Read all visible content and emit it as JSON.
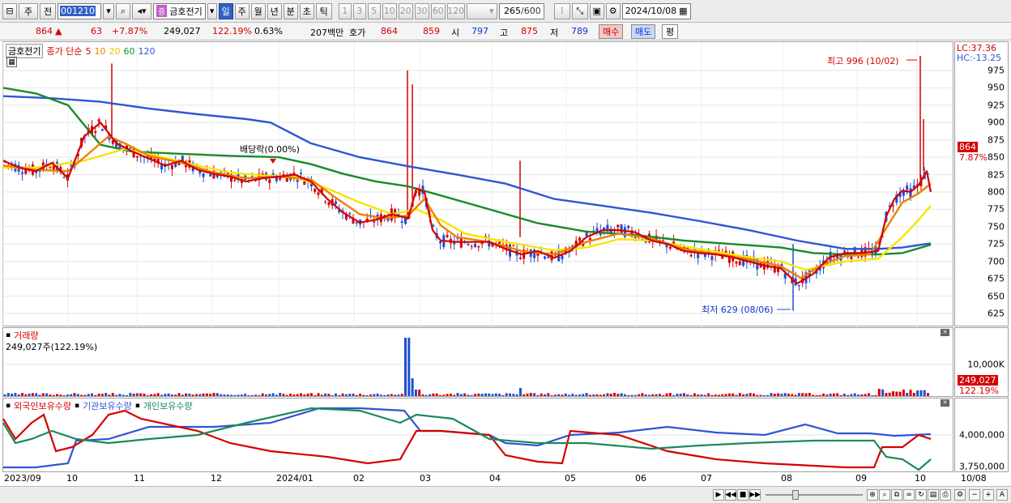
{
  "toolbar": {
    "period_type": "주",
    "prefix": "전",
    "code": "001210",
    "stock_tag": "증",
    "stock_name": "금호전기",
    "periods": [
      "일",
      "주",
      "월",
      "년",
      "분",
      "초",
      "틱"
    ],
    "active_period": "일",
    "intervals": [
      "1",
      "3",
      "5",
      "10",
      "20",
      "30",
      "60",
      "120"
    ],
    "count": "265",
    "total": "/600",
    "date": "2024/10/08"
  },
  "quote": {
    "price": "864",
    "arrow": "▲",
    "change": "63",
    "change_pct": "+7.87%",
    "volume": "249,027",
    "vol_ratio": "122.19%",
    "turnover": "0.63%",
    "amount": "207백만",
    "bid_label": "호가",
    "ask": "864",
    "bid": "859",
    "open_label": "시",
    "open": "797",
    "high_label": "고",
    "high": "875",
    "low_label": "저",
    "low": "789",
    "buy": "매수",
    "sell": "매도",
    "eval": "평"
  },
  "price_panel": {
    "name": "금호전기",
    "ma_label": "종가 단순",
    "ma_periods": [
      "5",
      "10",
      "20",
      "60",
      "120"
    ],
    "ma_colors": [
      "#d40000",
      "#f08000",
      "#f0e000",
      "#1a8a2a",
      "#2f55d4"
    ],
    "lc": "LC:37.36",
    "hc": "HC:-13.25",
    "y_ticks": [
      "975",
      "950",
      "925",
      "900",
      "875",
      "850",
      "825",
      "800",
      "775",
      "750",
      "725",
      "700",
      "675",
      "650",
      "625"
    ],
    "current_tag": "864",
    "current_pct": "7.87%",
    "high_ann": "최고 996 (10/02)",
    "low_ann": "최저 629 (08/06)",
    "dividend_ann": "배당락(0.00%)"
  },
  "volume_panel": {
    "title": "거래량",
    "value": "249,027주(122.19%)",
    "y_tick": "10,000K",
    "current_tag": "249,027",
    "current_pct": "122.19%"
  },
  "holding_panel": {
    "foreign": "외국인보유수량",
    "institution": "기관보유수량",
    "individual": "개인보유수량",
    "colors": [
      "#d40000",
      "#2f55d4",
      "#1a8a5a"
    ],
    "y_ticks": [
      "4,000,000",
      "3,750,000"
    ]
  },
  "x_labels": [
    "2023/09",
    "10",
    "11",
    "12",
    "2024/01",
    "02",
    "03",
    "04",
    "05",
    "06",
    "07",
    "08",
    "09",
    "10",
    "10/08"
  ],
  "chart_data": {
    "type": "line",
    "ylim": [
      610,
      990
    ],
    "ma5": [
      [
        0,
        845
      ],
      [
        20,
        835
      ],
      [
        40,
        830
      ],
      [
        60,
        842
      ],
      [
        80,
        820
      ],
      [
        100,
        880
      ],
      [
        120,
        900
      ],
      [
        140,
        870
      ],
      [
        160,
        858
      ],
      [
        180,
        848
      ],
      [
        200,
        838
      ],
      [
        220,
        845
      ],
      [
        240,
        832
      ],
      [
        260,
        826
      ],
      [
        280,
        822
      ],
      [
        300,
        815
      ],
      [
        320,
        820
      ],
      [
        340,
        822
      ],
      [
        360,
        825
      ],
      [
        380,
        815
      ],
      [
        400,
        790
      ],
      [
        420,
        770
      ],
      [
        440,
        756
      ],
      [
        460,
        760
      ],
      [
        480,
        768
      ],
      [
        500,
        762
      ],
      [
        510,
        805
      ],
      [
        520,
        800
      ],
      [
        530,
        745
      ],
      [
        540,
        730
      ],
      [
        560,
        728
      ],
      [
        580,
        728
      ],
      [
        600,
        728
      ],
      [
        620,
        718
      ],
      [
        640,
        710
      ],
      [
        660,
        715
      ],
      [
        680,
        705
      ],
      [
        700,
        715
      ],
      [
        720,
        735
      ],
      [
        740,
        745
      ],
      [
        760,
        745
      ],
      [
        780,
        742
      ],
      [
        800,
        730
      ],
      [
        820,
        725
      ],
      [
        840,
        715
      ],
      [
        860,
        712
      ],
      [
        880,
        710
      ],
      [
        900,
        706
      ],
      [
        920,
        700
      ],
      [
        940,
        694
      ],
      [
        960,
        690
      ],
      [
        980,
        668
      ],
      [
        1000,
        682
      ],
      [
        1020,
        706
      ],
      [
        1040,
        712
      ],
      [
        1060,
        712
      ],
      [
        1080,
        715
      ],
      [
        1090,
        765
      ],
      [
        1100,
        790
      ],
      [
        1110,
        802
      ],
      [
        1120,
        800
      ],
      [
        1130,
        810
      ],
      [
        1140,
        830
      ],
      [
        1145,
        800
      ]
    ],
    "ma10": [
      [
        0,
        838
      ],
      [
        40,
        832
      ],
      [
        80,
        830
      ],
      [
        110,
        860
      ],
      [
        130,
        880
      ],
      [
        150,
        870
      ],
      [
        180,
        852
      ],
      [
        220,
        842
      ],
      [
        260,
        828
      ],
      [
        300,
        820
      ],
      [
        340,
        822
      ],
      [
        380,
        818
      ],
      [
        410,
        792
      ],
      [
        440,
        768
      ],
      [
        470,
        762
      ],
      [
        500,
        766
      ],
      [
        520,
        790
      ],
      [
        540,
        752
      ],
      [
        560,
        735
      ],
      [
        600,
        728
      ],
      [
        640,
        715
      ],
      [
        680,
        710
      ],
      [
        720,
        728
      ],
      [
        760,
        740
      ],
      [
        800,
        733
      ],
      [
        840,
        718
      ],
      [
        880,
        711
      ],
      [
        920,
        703
      ],
      [
        960,
        693
      ],
      [
        985,
        676
      ],
      [
        1010,
        695
      ],
      [
        1040,
        708
      ],
      [
        1070,
        710
      ],
      [
        1090,
        748
      ],
      [
        1110,
        785
      ],
      [
        1130,
        798
      ],
      [
        1145,
        812
      ]
    ],
    "ma20": [
      [
        0,
        835
      ],
      [
        40,
        835
      ],
      [
        100,
        845
      ],
      [
        150,
        862
      ],
      [
        190,
        852
      ],
      [
        240,
        838
      ],
      [
        280,
        828
      ],
      [
        320,
        824
      ],
      [
        360,
        822
      ],
      [
        400,
        805
      ],
      [
        440,
        785
      ],
      [
        480,
        768
      ],
      [
        510,
        775
      ],
      [
        540,
        760
      ],
      [
        570,
        740
      ],
      [
        620,
        728
      ],
      [
        680,
        716
      ],
      [
        720,
        720
      ],
      [
        760,
        732
      ],
      [
        800,
        730
      ],
      [
        860,
        718
      ],
      [
        920,
        706
      ],
      [
        960,
        700
      ],
      [
        990,
        688
      ],
      [
        1040,
        700
      ],
      [
        1080,
        704
      ],
      [
        1110,
        735
      ],
      [
        1130,
        760
      ],
      [
        1145,
        780
      ]
    ],
    "ma60": [
      [
        0,
        950
      ],
      [
        40,
        942
      ],
      [
        80,
        925
      ],
      [
        120,
        868
      ],
      [
        160,
        858
      ],
      [
        220,
        855
      ],
      [
        280,
        852
      ],
      [
        340,
        850
      ],
      [
        380,
        840
      ],
      [
        420,
        826
      ],
      [
        460,
        815
      ],
      [
        500,
        808
      ],
      [
        540,
        795
      ],
      [
        600,
        775
      ],
      [
        660,
        755
      ],
      [
        720,
        743
      ],
      [
        780,
        738
      ],
      [
        840,
        730
      ],
      [
        900,
        725
      ],
      [
        960,
        720
      ],
      [
        1000,
        712
      ],
      [
        1040,
        710
      ],
      [
        1080,
        710
      ],
      [
        1110,
        712
      ],
      [
        1145,
        724
      ]
    ],
    "ma120": [
      [
        0,
        938
      ],
      [
        60,
        935
      ],
      [
        120,
        930
      ],
      [
        180,
        920
      ],
      [
        240,
        912
      ],
      [
        300,
        905
      ],
      [
        330,
        900
      ],
      [
        380,
        870
      ],
      [
        440,
        850
      ],
      [
        500,
        837
      ],
      [
        560,
        825
      ],
      [
        620,
        812
      ],
      [
        680,
        790
      ],
      [
        740,
        780
      ],
      [
        800,
        770
      ],
      [
        860,
        758
      ],
      [
        920,
        745
      ],
      [
        980,
        730
      ],
      [
        1040,
        718
      ],
      [
        1080,
        718
      ],
      [
        1110,
        720
      ],
      [
        1145,
        726
      ]
    ]
  }
}
